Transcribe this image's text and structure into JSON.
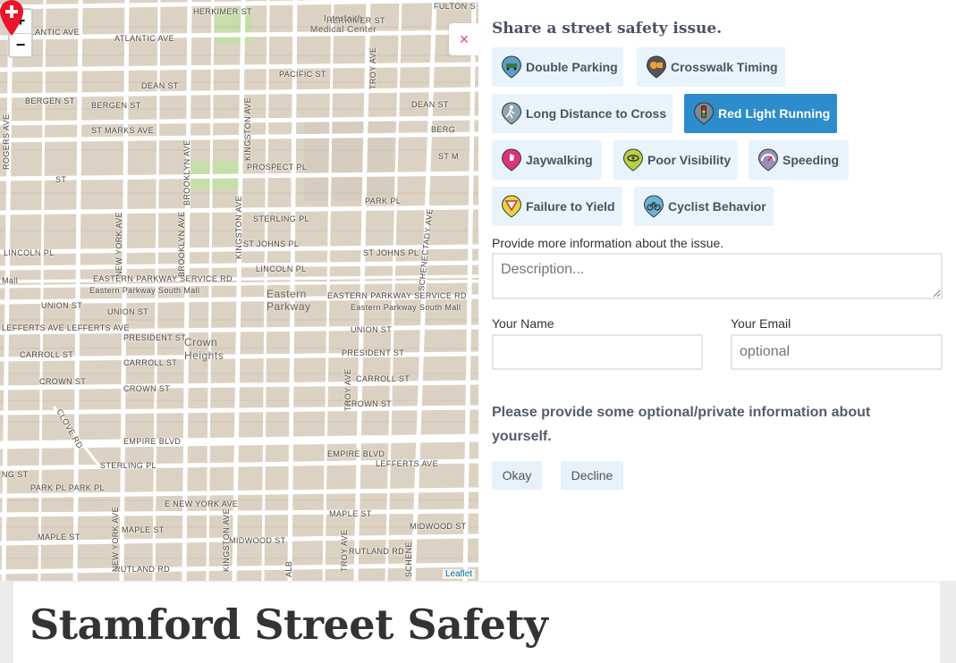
{
  "map": {
    "zoom_in": "+",
    "zoom_out": "−",
    "attribution": "Leaflet",
    "streets": [
      "HERKIMER ST",
      "FULTON S",
      "ATLANTIC AVE",
      "PACIFIC ST",
      "DEAN ST",
      "BERGEN ST",
      "ST MARKS AVE",
      "PROSPECT PL",
      "PARK PL",
      "STERLING PL",
      "ST JOHNS PL",
      "LINCOLN PL",
      "EASTERN PARKWAY SERVICE RD",
      "Eastern Parkway South Mall",
      "UNION ST",
      "PRESIDENT ST",
      "CARROLL ST",
      "CROWN ST",
      "EMPIRE BLVD",
      "LEFFERTS AVE",
      "E NEW YORK AVE",
      "MAPLE ST",
      "MIDWOOD ST",
      "RUTLAND RD",
      "ROGERS AVE",
      "NEW YORK AVE",
      "BROOKLYN AVE",
      "KINGSTON AVE",
      "TROY AVE",
      "SCHENECTADY AVE",
      "CLOVE RD",
      "Mall",
      "BERG",
      "ST M",
      "NG ST",
      "ST",
      "PARK PL PARK PL",
      "LEFFERTS AVE  LEFFERTS AVE",
      "ALB",
      "SCHENE"
    ],
    "areas": [
      "Interfaith Medical Center",
      "Eastern Parkway",
      "Crown Heights"
    ]
  },
  "panel": {
    "close": "×",
    "title": "Share a street safety issue.",
    "issues": [
      {
        "label": "Double Parking",
        "icon": "double-parking-icon",
        "color": "#5aa0c8"
      },
      {
        "label": "Crosswalk Timing",
        "icon": "crosswalk-timing-icon",
        "color": "#555555"
      },
      {
        "label": "Long Distance to Cross",
        "icon": "long-distance-icon",
        "color": "#8ea6b8"
      },
      {
        "label": "Red Light Running",
        "icon": "red-light-icon",
        "color": "#7a8b98",
        "active": true
      },
      {
        "label": "Jaywalking",
        "icon": "jaywalking-icon",
        "color": "#e0327e"
      },
      {
        "label": "Poor Visibility",
        "icon": "poor-visibility-icon",
        "color": "#b8d043"
      },
      {
        "label": "Speeding",
        "icon": "speeding-icon",
        "color": "#9a8fb8"
      },
      {
        "label": "Failure to Yield",
        "icon": "failure-to-yield-icon",
        "color": "#e8d444"
      },
      {
        "label": "Cyclist Behavior",
        "icon": "cyclist-icon",
        "color": "#6ab4d8"
      }
    ],
    "description_label": "Provide more information about the issue.",
    "description_placeholder": "Description...",
    "name_label": "Your Name",
    "name_value": "",
    "email_label": "Your Email",
    "email_placeholder": "optional",
    "info_text": "Please provide some optional/private information about yourself.",
    "okay": "Okay",
    "decline": "Decline"
  },
  "footer": {
    "site_title": "Stamford Street Safety"
  },
  "colors": {
    "accent": "#2d8ccb",
    "close": "#e6399b",
    "marker": "#e8152b"
  }
}
